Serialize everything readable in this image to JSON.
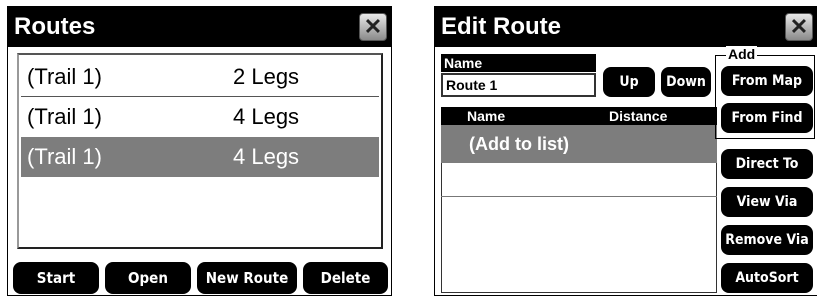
{
  "routes_dialog": {
    "title": "Routes",
    "close_glyph": "✕",
    "rows": [
      {
        "name": "(Trail 1)",
        "legs": "2 Legs",
        "selected": false
      },
      {
        "name": "(Trail 1)",
        "legs": "4 Legs",
        "selected": false
      },
      {
        "name": "(Trail 1)",
        "legs": "4 Legs",
        "selected": true
      }
    ],
    "buttons": {
      "start": "Start",
      "open": "Open",
      "new_route": "New Route",
      "delete": "Delete"
    }
  },
  "edit_route_dialog": {
    "title": "Edit Route",
    "close_glyph": "✕",
    "name_label": "Name",
    "name_value": "Route 1",
    "up_label": "Up",
    "down_label": "Down",
    "list_headers": {
      "name": "Name",
      "distance": "Distance"
    },
    "add_to_list": "(Add to list)",
    "add_group_label": "Add",
    "buttons": {
      "from_map": "From Map",
      "from_find": "From Find",
      "direct_to": "Direct To",
      "view_via": "View Via",
      "remove_via": "Remove Via",
      "autosort": "AutoSort"
    }
  },
  "colors": {
    "title_bar": "#000000",
    "selected_row": "#7d7d7d",
    "button": "#000000",
    "button_text": "#ffffff"
  }
}
